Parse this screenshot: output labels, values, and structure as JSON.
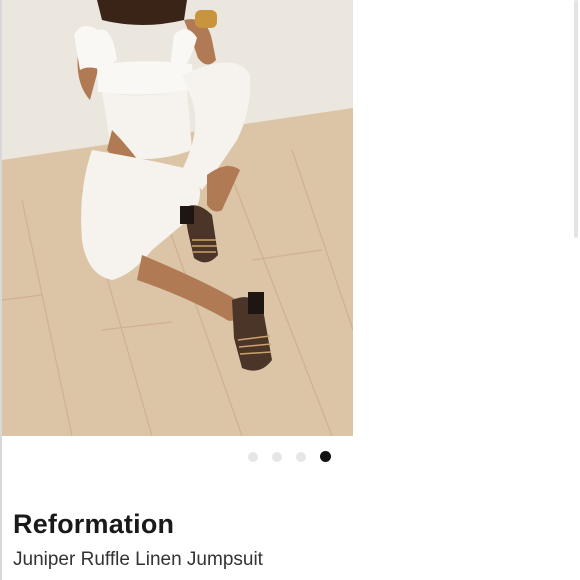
{
  "product": {
    "brand": "Reformation",
    "title": "Juniper Ruffle Linen Jumpsuit"
  },
  "carousel": {
    "total_images": 4,
    "active_index": 3
  },
  "colors": {
    "active_dot": "#111111",
    "inactive_dot": "#e6e6e6",
    "floor": "#dcc4a6",
    "wall": "#ebe6de"
  }
}
